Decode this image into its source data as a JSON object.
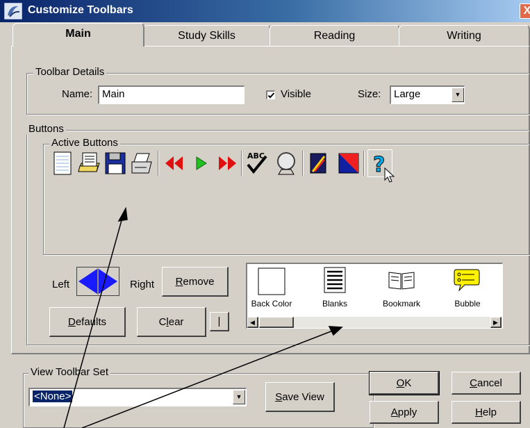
{
  "window": {
    "title": "Customize Toolbars",
    "close_glyph": "X"
  },
  "tabs": [
    "Main",
    "Study Skills",
    "Reading",
    "Writing"
  ],
  "toolbar_details": {
    "legend": "Toolbar Details",
    "name_label": "Name:",
    "name_value": "Main",
    "visible_label": "Visible",
    "visible_checked": true,
    "size_label": "Size:",
    "size_value": "Large"
  },
  "buttons_group": {
    "legend": "Buttons",
    "active_legend": "Active Buttons",
    "active_icons": [
      "page-icon",
      "open-document-icon",
      "save-disk-icon",
      "print-icon",
      "separator",
      "rewind-icon",
      "play-icon",
      "fast-forward-icon",
      "separator",
      "spellcheck-icon",
      "magnifier-icon",
      "separator",
      "color-book-icon",
      "color-square-icon",
      "separator",
      "help-icon"
    ],
    "left_label": "Left",
    "right_label": "Right",
    "remove_pre": "",
    "remove_u": "R",
    "remove_post": "emove",
    "defaults_pre": "",
    "defaults_u": "D",
    "defaults_post": "efaults",
    "clear_pre": "C",
    "clear_u": "l",
    "clear_post": "ear",
    "separator_btn": "|",
    "palette": [
      {
        "label": "Back Color",
        "icon": "back-color-icon"
      },
      {
        "label": "Blanks",
        "icon": "blanks-icon"
      },
      {
        "label": "Bookmark",
        "icon": "bookmark-icon"
      },
      {
        "label": "Bubble",
        "icon": "bubble-icon"
      }
    ]
  },
  "view_set": {
    "legend": "View Toolbar Set",
    "value": "<None>",
    "save_pre": "",
    "save_u": "S",
    "save_post": "ave View"
  },
  "dialog_buttons": {
    "ok_u": "O",
    "ok_post": "K",
    "cancel_u": "C",
    "cancel_post": "ancel",
    "apply_u": "A",
    "apply_post": "pply",
    "help_u": "H",
    "help_post": "elp"
  },
  "colors": {
    "title_start": "#0a246a",
    "face": "#d4d0c8"
  }
}
